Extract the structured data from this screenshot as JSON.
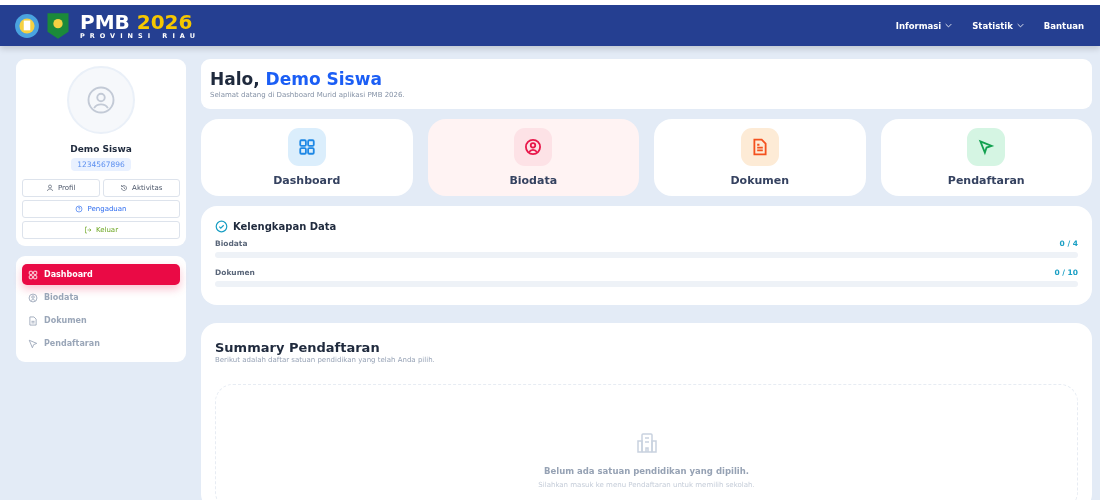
{
  "brand": {
    "title": "PMB",
    "year": "2026",
    "subtitle": "PROVINSI RIAU"
  },
  "nav": [
    {
      "label": "Informasi",
      "dropdown": true
    },
    {
      "label": "Statistik",
      "dropdown": true
    },
    {
      "label": "Bantuan",
      "dropdown": false
    }
  ],
  "profile": {
    "name": "Demo Siswa",
    "id": "1234567896",
    "buttons": [
      {
        "kind": "profile",
        "label": "Profil"
      },
      {
        "kind": "history",
        "label": "Aktivitas"
      },
      {
        "kind": "help",
        "label": "Pengaduan"
      },
      {
        "kind": "logout",
        "label": "Keluar"
      }
    ]
  },
  "sidebar": {
    "items": [
      {
        "kind": "grid",
        "label": "Dashboard",
        "selected": true
      },
      {
        "kind": "user",
        "label": "Biodata",
        "selected": false
      },
      {
        "kind": "doc",
        "label": "Dokumen",
        "selected": false
      },
      {
        "kind": "send",
        "label": "Pendaftaran",
        "selected": false
      }
    ]
  },
  "greeting": {
    "prefix": "Halo,",
    "name": "Demo Siswa",
    "subtitle": "Selamat datang di Dashboard Murid aplikasi PMB 2026."
  },
  "cards": [
    {
      "kind": "grid",
      "label": "Dashboard",
      "color": "#1e88e5",
      "selected": false
    },
    {
      "kind": "user",
      "label": "Biodata",
      "color": "#e8174a",
      "selected": true
    },
    {
      "kind": "doc",
      "label": "Dokumen",
      "color": "#f4511e",
      "selected": false
    },
    {
      "kind": "send",
      "label": "Pendaftaran",
      "color": "#12a150",
      "selected": false
    }
  ],
  "completeness": {
    "title": "Kelengkapan Data",
    "rows": [
      {
        "label": "Biodata",
        "value": "0 / 4",
        "level": 0
      },
      {
        "label": "Dokumen",
        "value": "0 / 10",
        "level": 0
      }
    ]
  },
  "summary": {
    "title": "Summary Pendaftaran",
    "subtitle": "Berikut adalah daftar satuan pendidikan yang telah Anda pilih.",
    "empty_title": "Belum ada satuan pendidikan yang dipilih.",
    "empty_hint": "Silahkan masuk ke menu Pendaftaran untuk memilih sekolah."
  }
}
